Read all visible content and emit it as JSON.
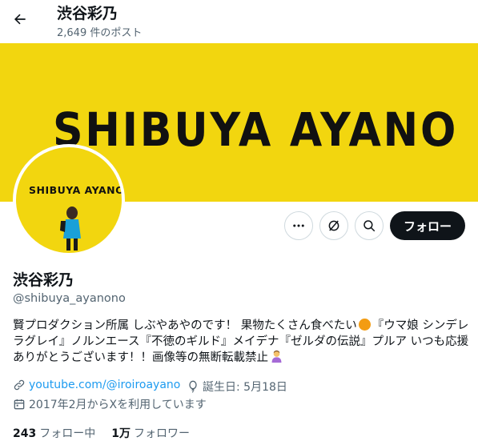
{
  "header": {
    "title": "渋谷彩乃",
    "post_count": "2,649 件のポスト"
  },
  "banner": {
    "text": "SHIBUYA AYANO",
    "bg_color": "#f2d60f"
  },
  "avatar": {
    "text": "SHIBUYA AYANO"
  },
  "actions": {
    "follow_label": "フォロー"
  },
  "profile": {
    "name": "渋谷彩乃",
    "handle": "@shibuya_ayanono",
    "bio_part1": "賢プロダクション所属 しぶやあやのです！ 果物たくさん食べたい",
    "bio_part2": "『ウマ娘 シンデレラグレイ』ノルンエース『不徳のギルド』メイデナ『ゼルダの伝説』プルア いつも応援ありがとうございます！！画像等の無断転載禁止",
    "website": "youtube.com/@iroiroayano",
    "birthday": "誕生日: 5月18日",
    "joined": "2017年2月からXを利用しています"
  },
  "stats": {
    "following_count": "243",
    "following_label": "フォロー中",
    "followers_count": "1万",
    "followers_label": "フォロワー"
  },
  "colors": {
    "accent": "#1d9bf0",
    "text": "#0f1419",
    "muted": "#536471",
    "banner": "#f2d60f"
  }
}
